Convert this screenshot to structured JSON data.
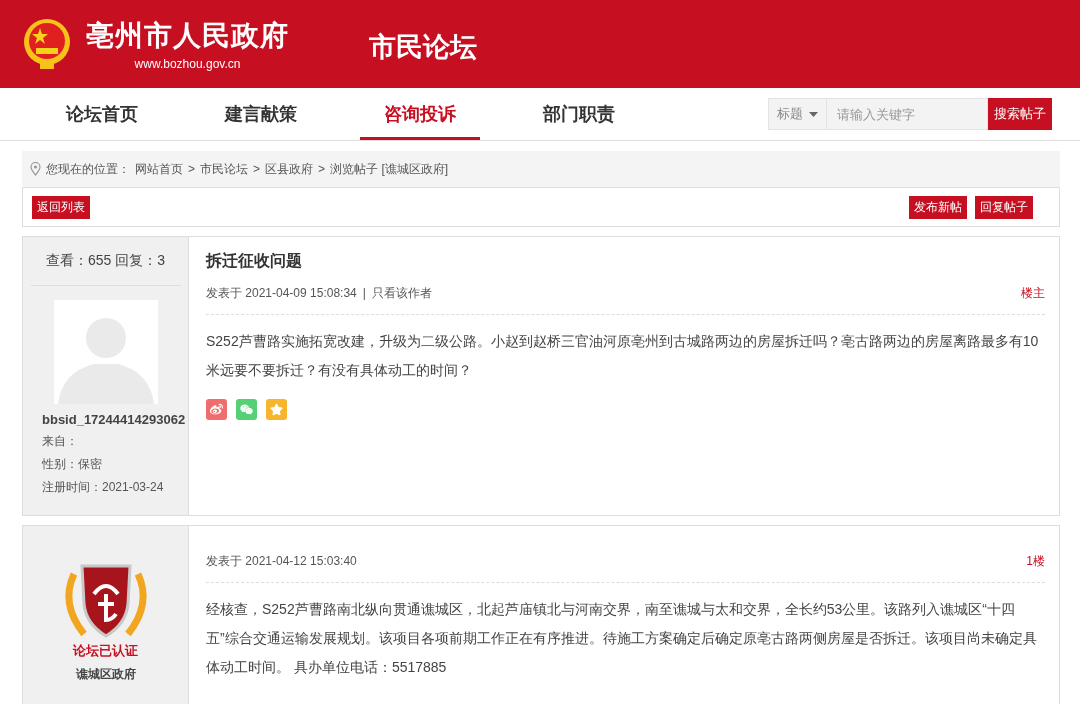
{
  "header": {
    "site_title": "亳州市人民政府",
    "site_url": "www.bozhou.gov.cn",
    "section_title": "市民论坛"
  },
  "nav": {
    "tabs": [
      {
        "label": "论坛首页",
        "selected": false
      },
      {
        "label": "建言献策",
        "selected": false
      },
      {
        "label": "咨询投诉",
        "selected": true
      },
      {
        "label": "部门职责",
        "selected": false
      }
    ]
  },
  "search": {
    "scope": "标题",
    "placeholder": "请输入关键字",
    "button": "搜索帖子"
  },
  "breadcrumb": {
    "prefix": "您现在的位置：",
    "separator": ">",
    "items": [
      "网站首页",
      "市民论坛",
      "区县政府",
      "浏览帖子 [谯城区政府]"
    ]
  },
  "actions": {
    "back": "返回列表",
    "buttons": [
      "发布新帖",
      "回复帖子"
    ]
  },
  "thread": {
    "stats": "查看：655 回复：3",
    "title": "拆迁征收问题"
  },
  "posts": [
    {
      "kind": "user",
      "author": "bbsid_17244414293062",
      "details": [
        "来自：",
        "性别：保密",
        "注册时间：2021-03-24"
      ],
      "date": "发表于 2021-04-09 15:08:34",
      "divider": "|",
      "author_only": "只看该作者",
      "floor": "楼主",
      "body": "S252芦曹路实施拓宽改建，升级为二级公路。小赵到赵桥三官油河原亳州到古城路两边的房屋拆迁吗？亳古路两边的房屋离路最多有10米远要不要拆迁？有没有具体动工的时间？"
    },
    {
      "kind": "official",
      "badge_text": "论坛已认证",
      "author": "谯城区政府",
      "date": "发表于 2021-04-12 15:03:40",
      "floor": "1楼",
      "body": "经核查，S252芦曹路南北纵向贯通谯城区，北起芦庙镇北与河南交界，南至谯城与太和交界，全长约53公里。该路列入谯城区“十四五”综合交通运输发展规划。该项目各项前期工作正在有序推进。待施工方案确定后确定原亳古路两侧房屋是否拆迁。该项目尚未确定具体动工时间。 具办单位电话：5517885"
    }
  ]
}
